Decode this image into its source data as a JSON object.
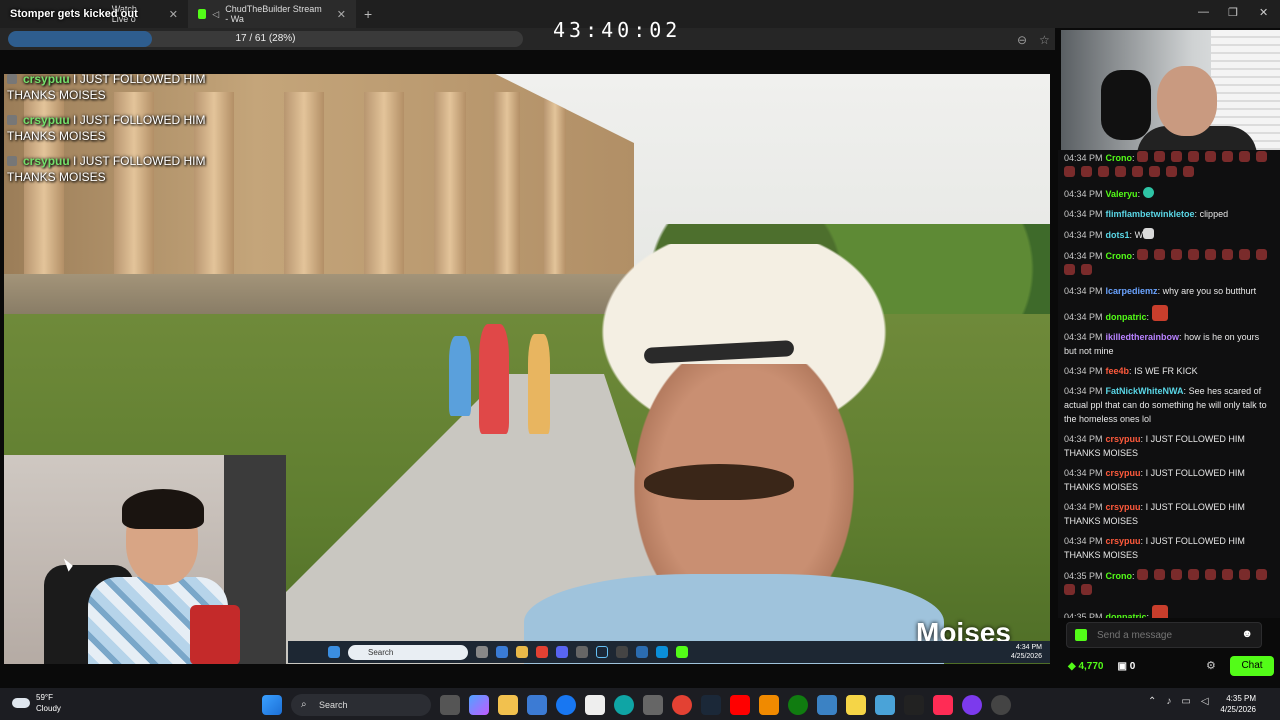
{
  "browser": {
    "overlay_title": "Stomper gets kicked out",
    "tabs": [
      {
        "label": "Watch Live o"
      },
      {
        "label": "ChudTheBuilder Stream - Wa"
      }
    ]
  },
  "progress": {
    "text": "17 / 61 (28%)",
    "fraction": 0.28
  },
  "timer": "43:40:02",
  "stream_chat_overlay": [
    {
      "user": "crsypuu",
      "text": "I JUST FOLLOWED HIM THANKS MOISES"
    },
    {
      "user": "crsypuu",
      "text": "I JUST FOLLOWED HIM THANKS MOISES"
    },
    {
      "user": "crsypuu",
      "text": "I JUST FOLLOWED HIM THANKS MOISES"
    }
  ],
  "name_tag": "Moises",
  "inner_taskbar": {
    "search": "Search",
    "time": "4:34 PM",
    "date": "4/25/2026"
  },
  "chat": {
    "messages": [
      {
        "time": "04:34 PM",
        "user": "Crono",
        "color": "#53fc18",
        "text": "",
        "emotes": 16
      },
      {
        "time": "04:34 PM",
        "user": "Valeryu",
        "color": "#53fc18",
        "text": "",
        "emotes": 0,
        "teal": true
      },
      {
        "time": "04:34 PM",
        "user": "flimflambetwinkletoe",
        "color": "#5ad6e6",
        "text": "clipped",
        "emotes": 0
      },
      {
        "time": "04:34 PM",
        "user": "dots1",
        "color": "#5ad6e6",
        "text": "W",
        "emotes": 0,
        "face": true
      },
      {
        "time": "04:34 PM",
        "user": "Crono",
        "color": "#53fc18",
        "text": "",
        "emotes": 10
      },
      {
        "time": "04:34 PM",
        "user": "lcarpediemz",
        "color": "#6aa3ff",
        "text": "why are you so butthurt",
        "emotes": 0
      },
      {
        "time": "04:34 PM",
        "user": "donpatric",
        "color": "#53fc18",
        "text": "",
        "emotes": 0,
        "big": true
      },
      {
        "time": "04:34 PM",
        "user": "ikilledtherainbow",
        "color": "#b882ff",
        "text": "how is he on yours but not mine",
        "emotes": 0
      },
      {
        "time": "04:34 PM",
        "user": "fee4b",
        "color": "#ff5a3c",
        "text": "IS WE FR KICK",
        "emotes": 0
      },
      {
        "time": "04:34 PM",
        "user": "FatNickWhiteNWA",
        "color": "#5ad6e6",
        "text": "See hes scared of actual ppl that can do something he will only talk to the homeless ones lol",
        "emotes": 0
      },
      {
        "time": "04:34 PM",
        "user": "crsypuu",
        "color": "#ff5a3c",
        "text": "I JUST FOLLOWED HIM THANKS MOISES",
        "emotes": 0
      },
      {
        "time": "04:34 PM",
        "user": "crsypuu",
        "color": "#ff5a3c",
        "text": "I JUST FOLLOWED HIM THANKS MOISES",
        "emotes": 0
      },
      {
        "time": "04:34 PM",
        "user": "crsypuu",
        "color": "#ff5a3c",
        "text": "I JUST FOLLOWED HIM THANKS MOISES",
        "emotes": 0
      },
      {
        "time": "04:34 PM",
        "user": "crsypuu",
        "color": "#ff5a3c",
        "text": "I JUST FOLLOWED HIM THANKS MOISES",
        "emotes": 0
      },
      {
        "time": "04:35 PM",
        "user": "Crono",
        "color": "#53fc18",
        "text": "",
        "emotes": 10
      },
      {
        "time": "04:35 PM",
        "user": "donpatric",
        "color": "#53fc18",
        "text": "",
        "emotes": 0,
        "big": true
      }
    ],
    "input_placeholder": "Send a message",
    "points": "4,770",
    "gifts": "0",
    "chat_button": "Chat"
  },
  "taskbar": {
    "weather_temp": "59°F",
    "weather_desc": "Cloudy",
    "search": "Search",
    "time": "4:35 PM",
    "date": "4/25/2026"
  }
}
